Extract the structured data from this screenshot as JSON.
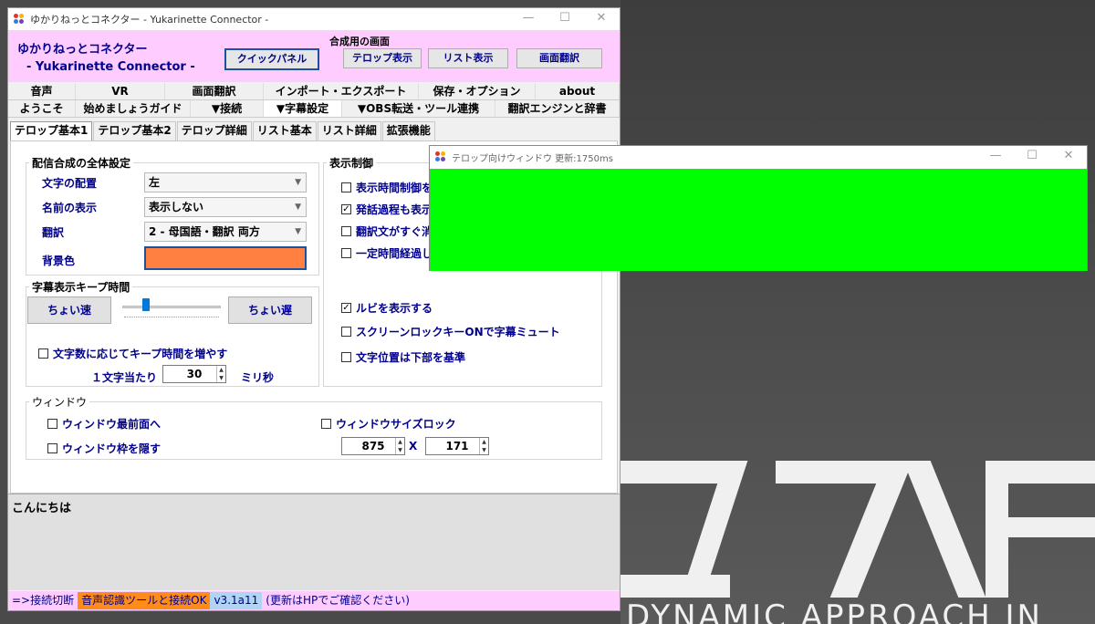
{
  "main_window": {
    "title": "ゆかりねっとコネクター  - Yukarinette Connector -",
    "controls": [
      "—",
      "☐",
      "✕"
    ],
    "header": {
      "name_line1": "ゆかりねっとコネクター",
      "name_line2": "- Yukarinette Connector -",
      "compose_label": "合成用の画面",
      "quick_panel": "クイックパネル",
      "telop_view": "テロップ表示",
      "list_view": "リスト表示",
      "screen_translate": "画面翻訳"
    },
    "tabs_row1": [
      "音声",
      "VR",
      "画面翻訳",
      "インポート・エクスポート",
      "保存・オプション",
      "about"
    ],
    "tabs_row2": [
      "ようこそ",
      "始めましょうガイド",
      "▼接続",
      "▼字幕設定",
      "▼OBS転送・ツール連携",
      "翻訳エンジンと辞書"
    ],
    "subtabs": [
      "テロップ基本1",
      "テロップ基本2",
      "テロップ詳細",
      "リスト基本",
      "リスト詳細",
      "拡張機能"
    ],
    "broadcast_group": {
      "title": "配信合成の全体設定",
      "text_align_label": "文字の配置",
      "text_align_value": "左",
      "name_display_label": "名前の表示",
      "name_display_value": "表示しない",
      "translation_label": "翻訳",
      "translation_value": "2 - 母国語・翻訳  両方",
      "bg_color_label": "背景色",
      "bg_color": "#ff8040"
    },
    "keep_group": {
      "title": "字幕表示キープ時間",
      "faster": "ちょい速",
      "slower": "ちょい遅",
      "slider_level": 0.2,
      "increase_by_chars": "文字数に応じてキープ時間を増やす",
      "per_char_label": "１文字当たり",
      "per_char_value": "30",
      "ms_label": "ミリ秒"
    },
    "display_group": {
      "title": "表示制御",
      "items": [
        {
          "label": "表示時間制御を",
          "checked": false
        },
        {
          "label": "発話過程も表示",
          "checked": true
        },
        {
          "label": "翻訳文がすぐ消",
          "checked": false
        },
        {
          "label": "一定時間経過し",
          "checked": false
        },
        {
          "label": "ルビを表示する",
          "checked": true
        },
        {
          "label": "スクリーンロックキーONで字幕ミュート",
          "checked": false
        },
        {
          "label": "文字位置は下部を基準",
          "checked": false
        }
      ]
    },
    "window_group": {
      "title": "ウィンドウ",
      "topmost": "ウィンドウ最前面へ",
      "hide_frame": "ウィンドウ枠を隠す",
      "size_lock": "ウィンドウサイズロック",
      "width": "875",
      "height": "171",
      "x_label": "X"
    },
    "log_text": "こんにちは",
    "status": {
      "disconnect": "=>接続切断",
      "connected": "音声認識ツールと接続OK",
      "version": "v3.1a11",
      "update_note": "(更新はHPでご確認ください)"
    }
  },
  "telop_window": {
    "title": "テロップ向けウィンドウ  更新:1750ms",
    "controls": [
      "—",
      "☐",
      "✕"
    ],
    "background": "#00ff00"
  },
  "wallpaper": {
    "text": "DYNAMIC APPROACH IN"
  }
}
